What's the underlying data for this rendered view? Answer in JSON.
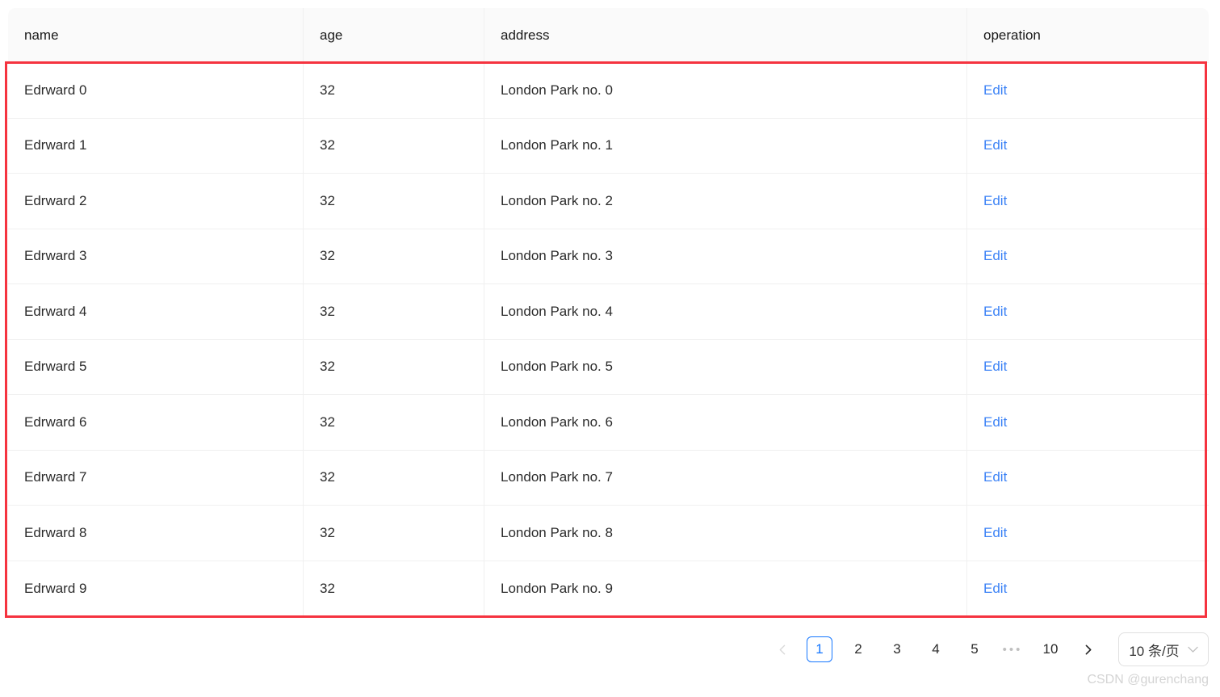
{
  "table": {
    "columns": [
      {
        "key": "name",
        "label": "name"
      },
      {
        "key": "age",
        "label": "age"
      },
      {
        "key": "address",
        "label": "address"
      },
      {
        "key": "operation",
        "label": "operation"
      }
    ],
    "rows": [
      {
        "name": "Edrward 0",
        "age": "32",
        "address": "London Park no. 0",
        "action": "Edit"
      },
      {
        "name": "Edrward 1",
        "age": "32",
        "address": "London Park no. 1",
        "action": "Edit"
      },
      {
        "name": "Edrward 2",
        "age": "32",
        "address": "London Park no. 2",
        "action": "Edit"
      },
      {
        "name": "Edrward 3",
        "age": "32",
        "address": "London Park no. 3",
        "action": "Edit"
      },
      {
        "name": "Edrward 4",
        "age": "32",
        "address": "London Park no. 4",
        "action": "Edit"
      },
      {
        "name": "Edrward 5",
        "age": "32",
        "address": "London Park no. 5",
        "action": "Edit"
      },
      {
        "name": "Edrward 6",
        "age": "32",
        "address": "London Park no. 6",
        "action": "Edit"
      },
      {
        "name": "Edrward 7",
        "age": "32",
        "address": "London Park no. 7",
        "action": "Edit"
      },
      {
        "name": "Edrward 8",
        "age": "32",
        "address": "London Park no. 8",
        "action": "Edit"
      },
      {
        "name": "Edrward 9",
        "age": "32",
        "address": "London Park no. 9",
        "action": "Edit"
      }
    ]
  },
  "pagination": {
    "prev_icon": "chevron-left-icon",
    "next_icon": "chevron-right-icon",
    "pages": [
      "1",
      "2",
      "3",
      "4",
      "5"
    ],
    "ellipsis": "•••",
    "last_page": "10",
    "current_page": "1",
    "page_size_label": "10 条/页",
    "page_size_icon": "chevron-down-icon"
  },
  "annotation": {
    "color": "#f5333f"
  },
  "watermark": {
    "text": "CSDN @gurenchang"
  },
  "colors": {
    "link": "#3b82f6",
    "active_page": "#1677ff",
    "header_bg": "#fafafa",
    "border": "#f0f0f0",
    "annotation": "#f5333f"
  }
}
